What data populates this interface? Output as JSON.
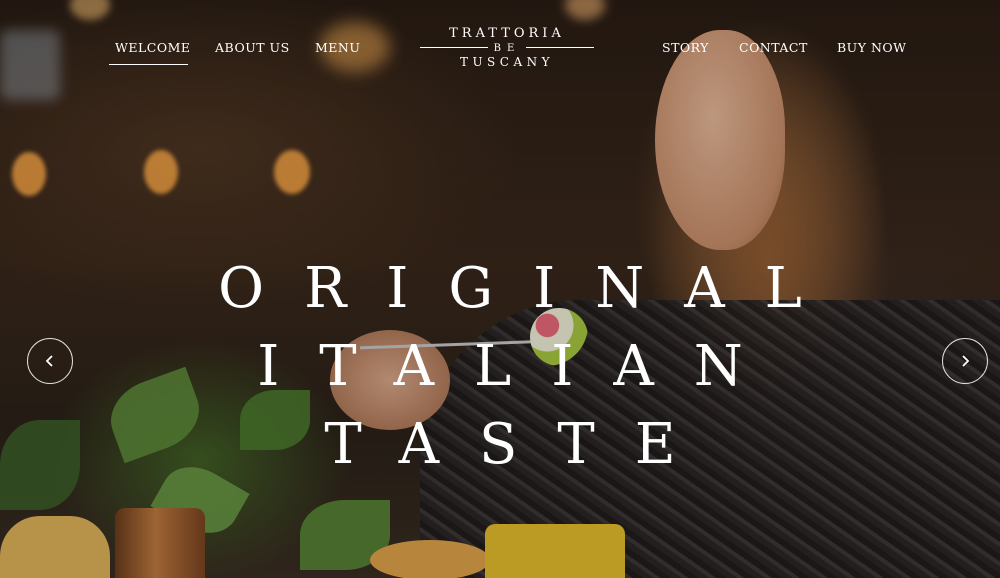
{
  "nav": {
    "welcome": "WELCOME",
    "about": "ABOUT US",
    "menu": "MENU",
    "story": "STORY",
    "contact": "CONTACT",
    "buy": "BUY NOW",
    "active": "WELCOME"
  },
  "logo": {
    "line1": "TRATTORIA",
    "line2": "BE",
    "line3": "TUSCANY"
  },
  "hero": {
    "line1": "ORIGINAL",
    "line2": "ITALIAN",
    "line3": "TASTE"
  },
  "slider": {
    "prev_icon": "chevron-left-icon",
    "next_icon": "chevron-right-icon"
  },
  "colors": {
    "text": "#ffffff",
    "background": "#2a1d14"
  }
}
